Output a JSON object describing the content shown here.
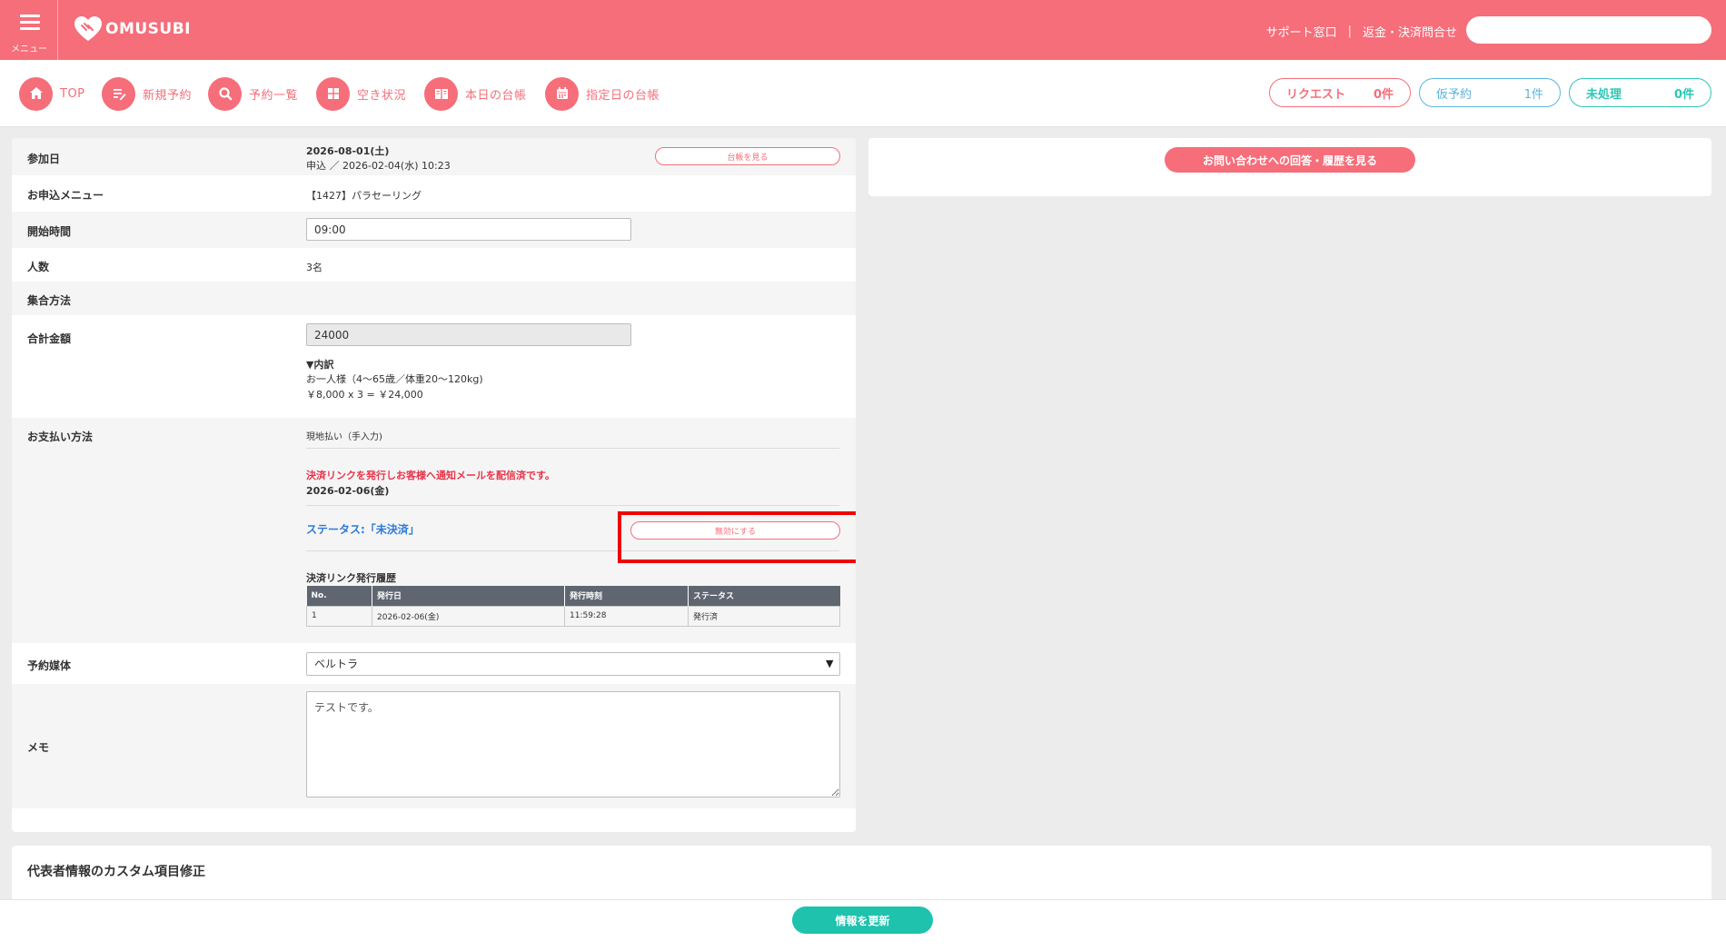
{
  "header": {
    "menu_label": "メニュー",
    "logo_text": "OMUSUBI",
    "links": [
      "サポート窓口",
      "返金・決済問合せ"
    ],
    "search_placeholder": ""
  },
  "nav": {
    "items": [
      {
        "label": "TOP",
        "icon": "home-icon"
      },
      {
        "label": "新規予約",
        "icon": "edit-icon"
      },
      {
        "label": "予約一覧",
        "icon": "search-icon"
      },
      {
        "label": "空き状況",
        "icon": "grid-icon"
      },
      {
        "label": "本日の台帳",
        "icon": "book-icon"
      },
      {
        "label": "指定日の台帳",
        "icon": "calendar-icon"
      }
    ],
    "status_pills": [
      {
        "label": "リクエスト",
        "count": "0件"
      },
      {
        "label": "仮予約",
        "count": "1件"
      },
      {
        "label": "未処理",
        "count": "0件"
      }
    ]
  },
  "form": {
    "participation_date": {
      "label": "参加日",
      "date": "2026-08-01(土)",
      "applied": "申込 ／ 2026-02-04(水) 10:23",
      "ledger_button": "台帳を見る"
    },
    "menu": {
      "label": "お申込メニュー",
      "value": "【1427】パラセーリング"
    },
    "start_time": {
      "label": "開始時間",
      "value": "09:00"
    },
    "people": {
      "label": "人数",
      "value": "3名"
    },
    "meeting": {
      "label": "集合方法",
      "value": ""
    },
    "total": {
      "label": "合計金額",
      "value": "24000",
      "breakdown_title": "▼内訳",
      "breakdown_line1": "お一人様（4〜65歳／体重20〜120kg)",
      "breakdown_line2": "￥8,000 x 3 = ￥24,000"
    },
    "payment": {
      "label": "お支払い方法",
      "method": "現地払い（手入力)",
      "notice": "決済リンクを発行しお客様へ通知メールを配信済です。",
      "date": "2026-02-06(金)",
      "status": "ステータス:「未決済」",
      "disable_button": "無効にする",
      "history_title": "決済リンク発行履歴",
      "history_headers": [
        "No.",
        "発行日",
        "発行時刻",
        "ステータス"
      ],
      "history_rows": [
        [
          "1",
          "2026-02-06(金)",
          "11:59:28",
          "発行済"
        ]
      ]
    },
    "media": {
      "label": "予約媒体",
      "value": "ベルトラ"
    },
    "memo": {
      "label": "メモ",
      "value": "テストです。"
    }
  },
  "right": {
    "inquiry_button": "お問い合わせへの回答・履歴を見る"
  },
  "bottom": {
    "title": "代表者情報のカスタム項目修正",
    "update_button": "情報を更新"
  },
  "colors": {
    "brand": "#f56e7a",
    "teal": "#1fc2ad",
    "blue": "#5bb5df",
    "alert_red": "#e8344a",
    "link_blue": "#2d7bd6"
  }
}
